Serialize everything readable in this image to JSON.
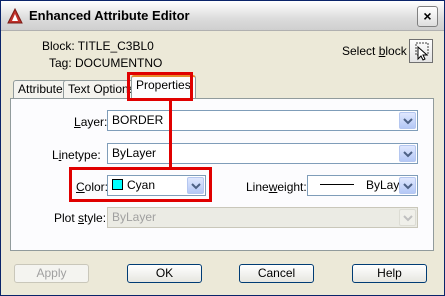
{
  "window": {
    "title": "Enhanced Attribute Editor",
    "close_label": "×"
  },
  "block": {
    "block_label": "Block: TITLE_C3BL0",
    "tag_label": "Tag: DOCUMENTNO",
    "select_block_label": "Select block"
  },
  "tabs": [
    {
      "label": "Attribute",
      "active": false
    },
    {
      "label": "Text Options",
      "active": false
    },
    {
      "label": "Properties",
      "active": true
    }
  ],
  "properties": {
    "layer_label": "Layer:",
    "layer_value": "BORDER",
    "linetype_label": "Linetype:",
    "linetype_value": "ByLayer",
    "color_label": "Color:",
    "color_value": "Cyan",
    "color_swatch": "#00ffff",
    "lineweight_label": "Lineweight:",
    "lineweight_value": "ByLayer",
    "plotstyle_label": "Plot style:",
    "plotstyle_value": "ByLayer"
  },
  "buttons": {
    "apply": "Apply",
    "ok": "OK",
    "cancel": "Cancel",
    "help": "Help"
  },
  "colors": {
    "highlight": "#e00000",
    "title_icon": "#c0302a"
  }
}
